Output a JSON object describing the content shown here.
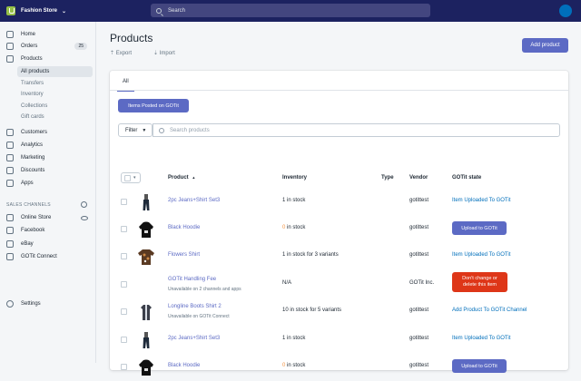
{
  "topbar": {
    "store_name": "Fashion Store",
    "search_placeholder": "Search"
  },
  "sidebar": {
    "nav": [
      {
        "label": "Home",
        "icon": "home-icon"
      },
      {
        "label": "Orders",
        "icon": "orders-icon",
        "badge": "25"
      },
      {
        "label": "Products",
        "icon": "tag-icon"
      }
    ],
    "product_sub": [
      "All products",
      "Transfers",
      "Inventory",
      "Collections",
      "Gift cards"
    ],
    "nav2": [
      {
        "label": "Customers",
        "icon": "customers-icon"
      },
      {
        "label": "Analytics",
        "icon": "analytics-icon"
      },
      {
        "label": "Marketing",
        "icon": "marketing-icon"
      },
      {
        "label": "Discounts",
        "icon": "discounts-icon"
      },
      {
        "label": "Apps",
        "icon": "apps-icon"
      }
    ],
    "channels_title": "SALES CHANNELS",
    "channels": [
      {
        "label": "Online Store",
        "icon": "store-icon"
      },
      {
        "label": "Facebook",
        "icon": "facebook-icon"
      },
      {
        "label": "eBay",
        "icon": "ebay-icon"
      },
      {
        "label": "GOTit Connect",
        "icon": "gotit-icon"
      }
    ],
    "settings": "Settings"
  },
  "main": {
    "title": "Products",
    "export": "Export",
    "import": "Import",
    "add_product": "Add product",
    "tab_all": "All",
    "gotit_button": "Items Posted on GOTit",
    "filter": "Filter",
    "search_placeholder": "Search products",
    "columns": [
      "Product",
      "Inventory",
      "Type",
      "Vendor",
      "GOTit state"
    ],
    "sort_indicator": "▲",
    "rows": [
      {
        "name": "2pc Jeans+Shirt Set3",
        "inv": "1 in stock",
        "vendor": "gotittest",
        "state_link": "Item Uploaded To GOTit",
        "thumb": "jeans"
      },
      {
        "name": "Black Hoodie",
        "inv_warn": "0",
        "inv": " in stock",
        "vendor": "gotittest",
        "state_button": "Upload to GOTit",
        "thumb": "hoodie"
      },
      {
        "name": "Flowers Shirt",
        "inv": "1 in stock for 3 variants",
        "vendor": "gotittest",
        "state_link": "Item Uploaded To GOTit",
        "thumb": "shirt"
      },
      {
        "name": "GOTit Handling Fee",
        "sub": "Unavailable on 2 channels and apps",
        "inv": "N/A",
        "vendor": "GOTit Inc.",
        "state_red": [
          "Don't change or",
          "delete this item"
        ],
        "thumb": "none"
      },
      {
        "name": "Longline Boots Shirt 2",
        "sub": "Unavailable on GOTit Connect",
        "inv": "10 in stock for 5 variants",
        "vendor": "gotittest",
        "state_link": "Add Product To GOTit Channel",
        "thumb": "longline"
      },
      {
        "name": "2pc Jeans+Shirt Set3",
        "inv": "1 in stock",
        "vendor": "gotittest",
        "state_link": "Item Uploaded To GOTit",
        "thumb": "jeans"
      },
      {
        "name": "Black Hoodie",
        "inv_warn": "0",
        "inv": " in stock",
        "vendor": "gotittest",
        "state_button": "Upload to GOTit",
        "thumb": "hoodie"
      }
    ]
  },
  "colors": {
    "topbar": "#1c2260",
    "accent": "#5c6ac4",
    "danger": "#de3618",
    "link": "#006fbb"
  }
}
